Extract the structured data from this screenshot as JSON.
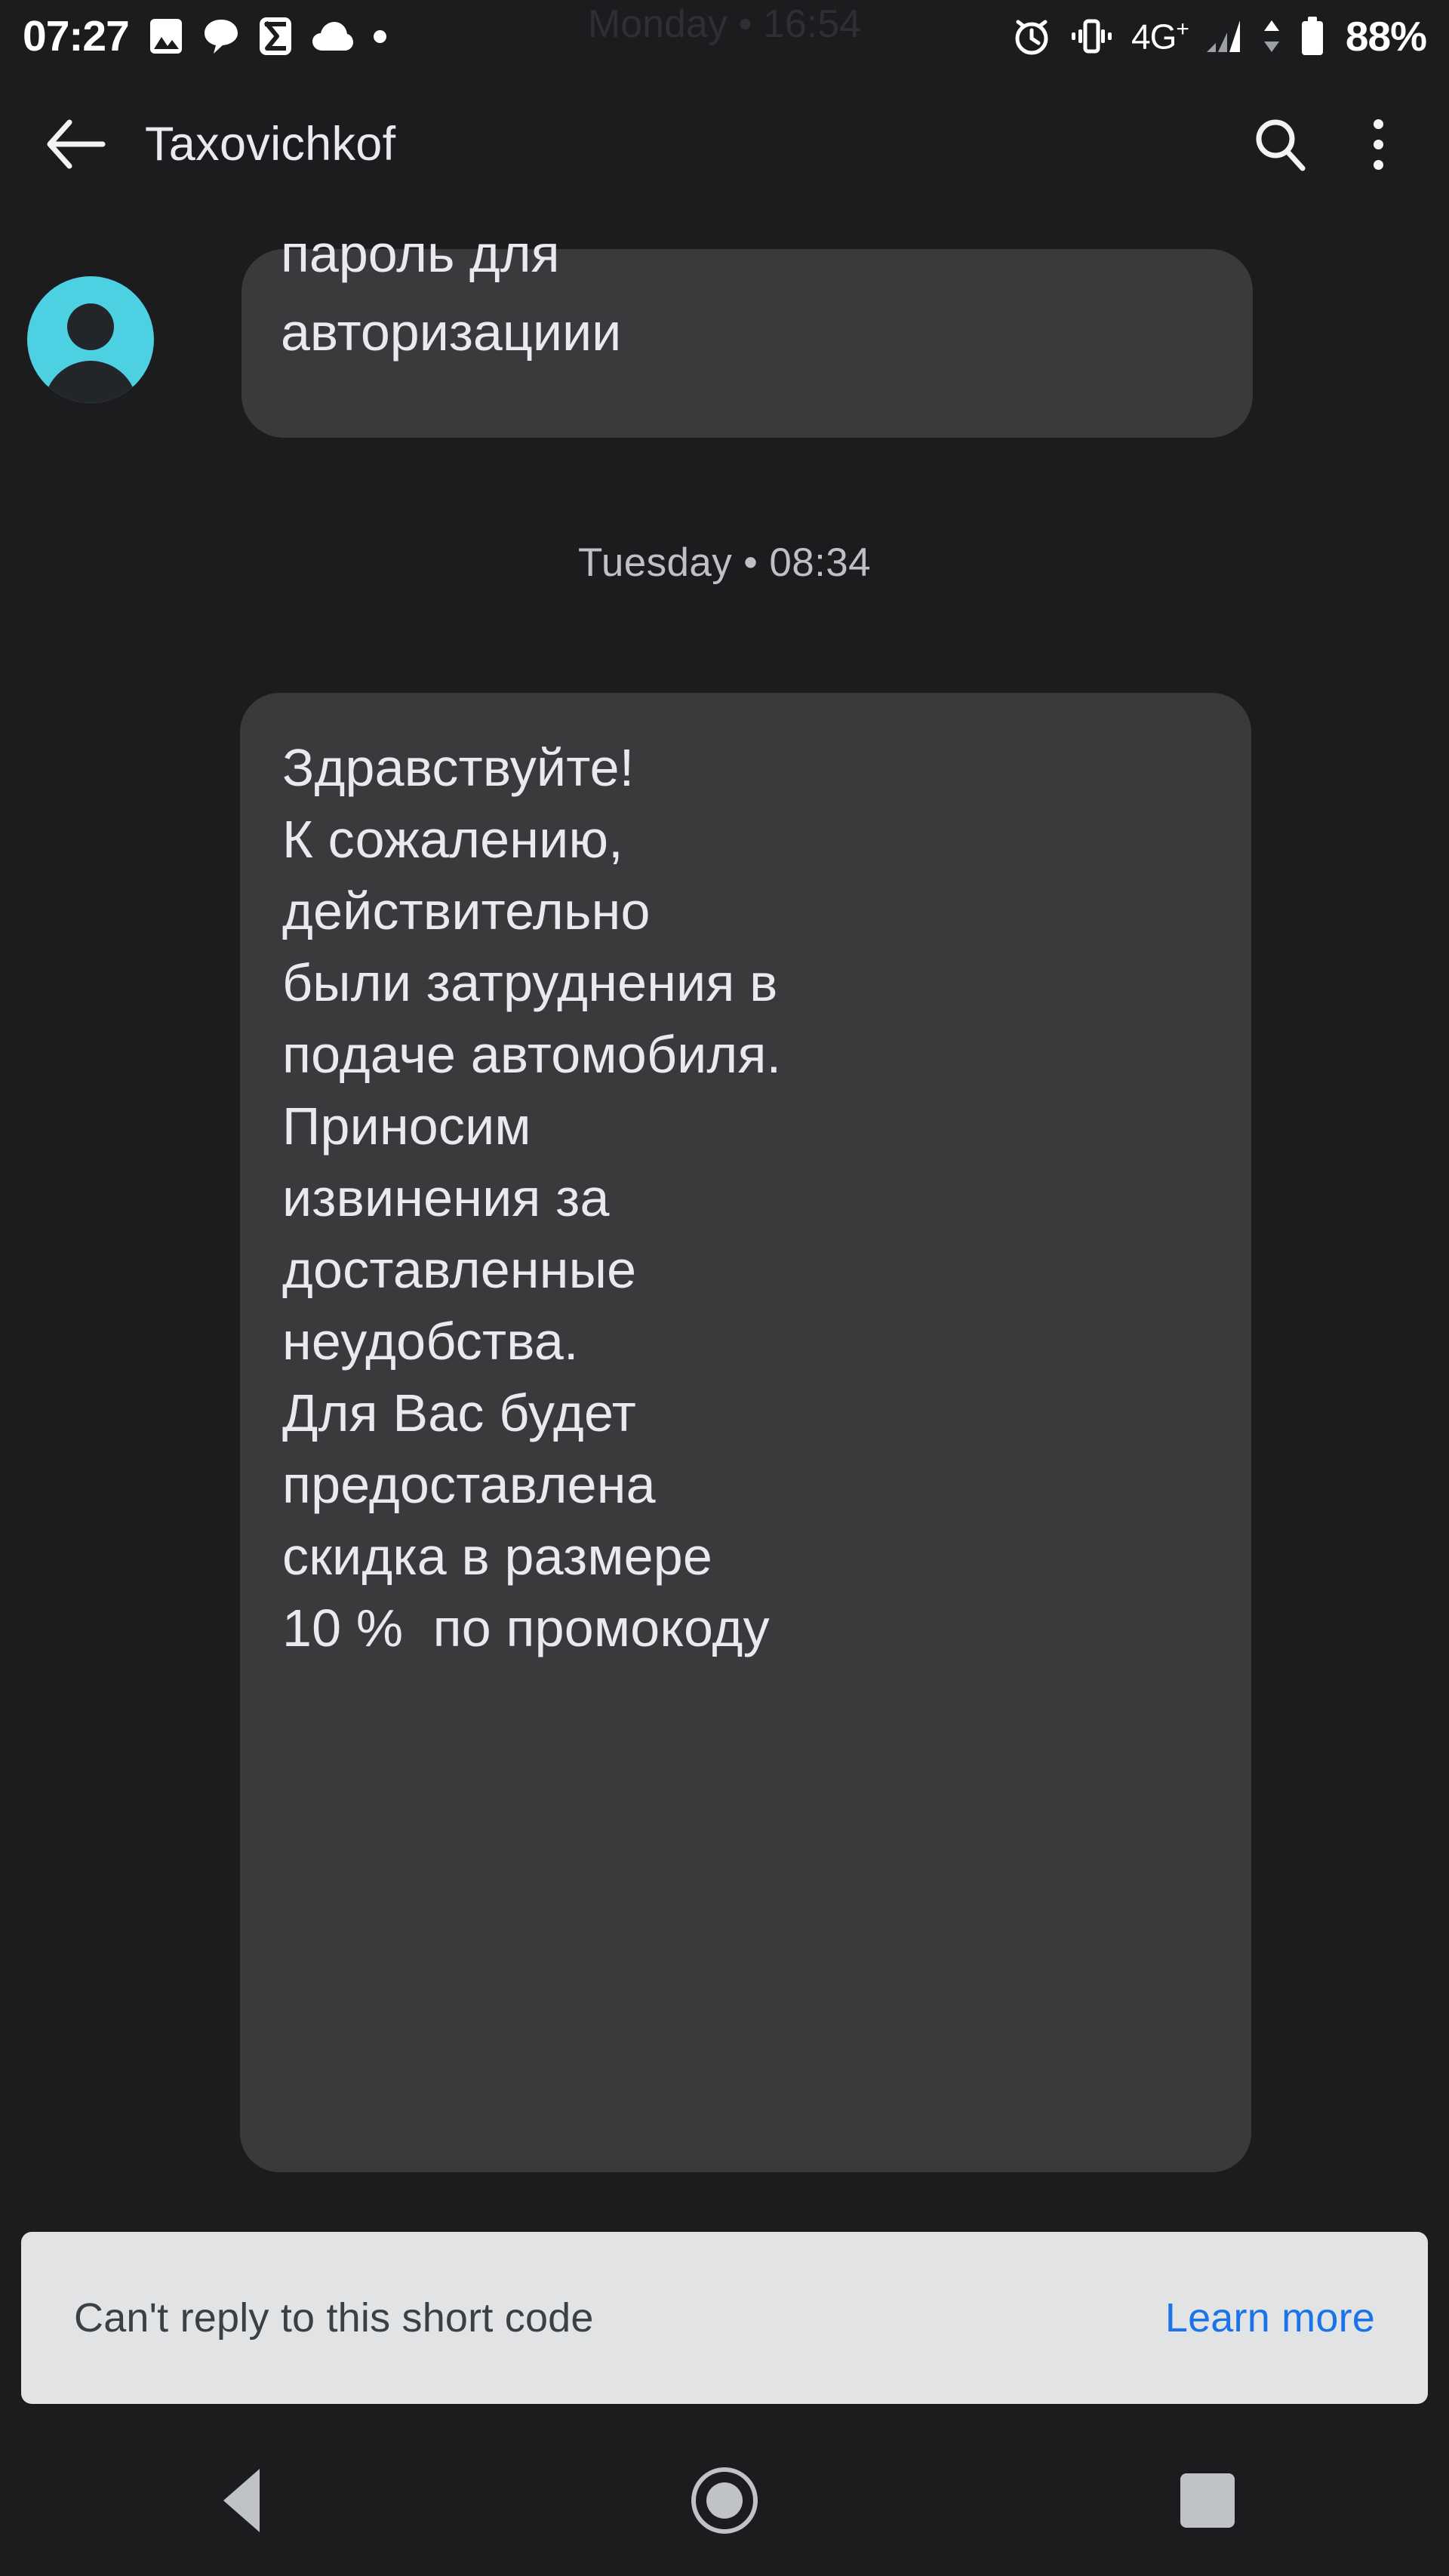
{
  "status_bar": {
    "clock": "07:27",
    "battery_percent": "88%",
    "network_label": "4G",
    "network_sup": "+",
    "icons": [
      "image-icon",
      "message-bubble-icon",
      "sigma-icon",
      "cloud-icon",
      "dot-icon",
      "alarm-clock-icon",
      "vibrate-icon",
      "signal-bars-icon",
      "data-transfer-arrows-icon",
      "battery-icon"
    ]
  },
  "ghost": {
    "date_divider": "Monday • 16:54",
    "message_line1": "пароль для",
    "message_line2": "авторизациии"
  },
  "app_bar": {
    "title": "Taxovichkof",
    "back_icon": "arrow-back-icon",
    "search_icon": "search-icon",
    "overflow_icon": "more-vert-icon"
  },
  "conversation": {
    "date_divider": "Tuesday • 08:34",
    "message_body": "Здравствуйте!\nК сожалению,\nдействительно\nбыли затруднения в\nподаче автомобиля.\nПриносим\nизвинения за\nдоставленные\nнеудобства.\nДля Вас будет\nпредоставлена\nскидка в размере\n10 %  по промокоду"
  },
  "short_code_banner": {
    "message": "Can't reply to this short code",
    "link_label": "Learn more"
  },
  "nav_bar": {
    "back_label": "back-icon",
    "home_label": "home-icon",
    "recents_label": "recents-icon"
  },
  "colors": {
    "background": "#1c1c1e",
    "bubble": "#3a3a3c",
    "bubble_text": "#e8eaed",
    "avatar": "#4dd0e1",
    "banner_bg": "#e2e3e5",
    "link": "#1a73e8",
    "nav_icon": "#bfc2c6"
  }
}
